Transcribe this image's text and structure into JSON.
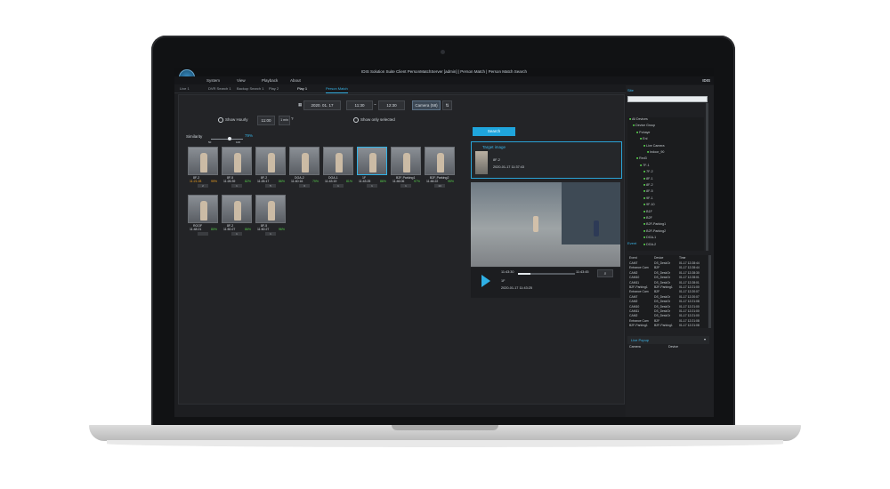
{
  "window": {
    "title": "IDIS Solution Suite Client PersonMatchServer [admin] | Person Match | Person Match Search",
    "brand": "IDIS"
  },
  "menu": [
    "System",
    "View",
    "Playback",
    "About"
  ],
  "tabs": [
    "Live 1",
    "DVR Search 1",
    "Backup Search 1",
    "Play 2",
    "Play 1",
    "Person Match"
  ],
  "toolbar": {
    "date": "2020. 01. 17",
    "time_from": "11:30",
    "time_to": "12:30",
    "camera_button": "Camera (58)"
  },
  "options": {
    "show_hourly": "Show Hourly",
    "hour_value": "11:00",
    "per_page": "1 min",
    "show_selected": "Show only selected"
  },
  "similarity": {
    "label": "Similarity",
    "value": "79%",
    "min": "50",
    "max": "100",
    "level": 0.58
  },
  "results": [
    {
      "name": "8F-2",
      "time": "11:21:28",
      "pct": "99%",
      "badge": "2",
      "highlight": true
    },
    {
      "name": "8F-5",
      "time": "11:26:39",
      "pct": "82%",
      "badge": "1",
      "highlight": false
    },
    {
      "name": "8F-2",
      "time": "11:26:17",
      "pct": "86%",
      "badge": "5",
      "highlight": false
    },
    {
      "name": "DGA-2",
      "time": "11:40:16",
      "pct": "79%",
      "badge": "3",
      "highlight": false
    },
    {
      "name": "DGA-1",
      "time": "11:43:19",
      "pct": "81%",
      "badge": "1",
      "highlight": false
    },
    {
      "name": "1F",
      "time": "11:43:25",
      "pct": "86%",
      "badge": "1",
      "highlight": false
    },
    {
      "name": "B2F-Parking1",
      "time": "11:46:06",
      "pct": "97%",
      "badge": "1",
      "highlight": false
    },
    {
      "name": "B2F-Parking2",
      "time": "11:46:22",
      "pct": "95%",
      "badge": "14",
      "highlight": false
    },
    {
      "name": "ROOF",
      "time": "11:48:21",
      "pct": "80%",
      "badge": "",
      "highlight": false
    },
    {
      "name": "8F-2",
      "time": "11:50:27",
      "pct": "86%",
      "badge": "1",
      "highlight": false
    },
    {
      "name": "8F-5",
      "time": "11:50:27",
      "pct": "96%",
      "badge": "1",
      "highlight": false
    }
  ],
  "search_button": "Search",
  "target": {
    "heading": "Target image",
    "camera": "8F-2",
    "datetime": "2020-01-17 11:37:43"
  },
  "player": {
    "time_start": "11:43:30",
    "time_end": "11:43:45",
    "camera": "1F",
    "datetime": "2020-01-17 11:43:25"
  },
  "site": {
    "heading": "Site",
    "nodes": [
      "All Devices",
      "Device Group",
      "Pohaye",
      "Enl",
      "Live Camera",
      "Indoor_90",
      "Red3",
      "7F-1",
      "7F-2",
      "8F-1",
      "8F-2",
      "8F-5",
      "9F-1",
      "9F-10",
      "B1F",
      "B2F",
      "B2F-Parking1",
      "B2F-Parking2",
      "DGA-1",
      "DGA-2"
    ]
  },
  "event": {
    "heading": "Event",
    "columns": [
      "Event",
      "Device",
      "Time"
    ],
    "rows": [
      [
        "CAM7",
        "DS_DeskGr",
        "01-17 12:28:44"
      ],
      [
        "Entrance Cam",
        "B2F",
        "01-17 12:28:44"
      ],
      [
        "CAM2",
        "DS_DeskGr",
        "01-17 12:28:30"
      ],
      [
        "CAM10",
        "DS_DeskGr",
        "01-17 12:28:01"
      ],
      [
        "CAM11",
        "DS_DeskGr",
        "01-17 12:28:01"
      ],
      [
        "B2F-Parking1",
        "B2F-Parking1",
        "01-17 12:21:00"
      ],
      [
        "Entrance Cam",
        "B2F",
        "01-17 12:20:07"
      ],
      [
        "CAM7",
        "DS_DeskGr",
        "01-17 12:20:07"
      ],
      [
        "CAM2",
        "DS_DeskGr",
        "01-17 12:21:08"
      ],
      [
        "CAM10",
        "DS_DeskGr",
        "01-17 12:21:00"
      ],
      [
        "CAM11",
        "DS_DeskGr",
        "01-17 12:21:00"
      ],
      [
        "CAM2",
        "DS_DeskGr",
        "01-17 12:21:00"
      ],
      [
        "Entrance Cam",
        "B2F",
        "01-17 12:21:08"
      ],
      [
        "B2F-Parking1",
        "B2F-Parking1",
        "01-17 12:21:08"
      ]
    ]
  },
  "live_popup": {
    "heading": "Live Popup",
    "columns": [
      "Camera",
      "Device"
    ]
  },
  "colors": {
    "accent": "#1fa5dc",
    "match_green": "#57d14c",
    "match_orange": "#f0a020"
  }
}
